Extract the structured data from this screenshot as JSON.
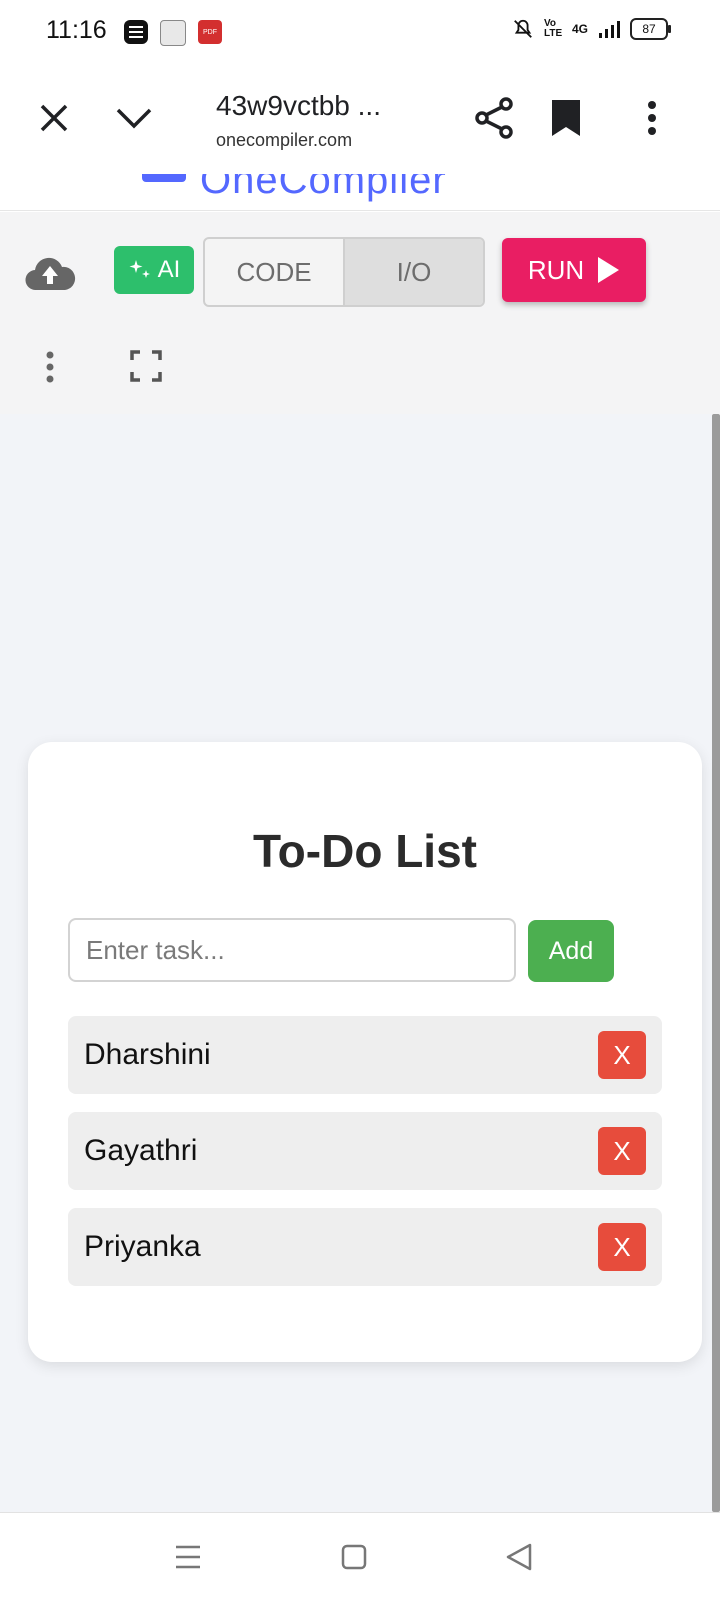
{
  "status_bar": {
    "time": "11:16",
    "network": "4G",
    "volte": "Vo LTE",
    "battery": "87"
  },
  "browser": {
    "title": "43w9vctbb ...",
    "url": "onecompiler.com"
  },
  "site": {
    "brand": "OneCompiler"
  },
  "editor_toolbar": {
    "ai_label": "AI",
    "code_tab": "CODE",
    "io_tab": "I/O",
    "run_label": "RUN"
  },
  "todo": {
    "title": "To-Do List",
    "input_placeholder": "Enter task...",
    "input_value": "",
    "add_label": "Add",
    "tasks": [
      {
        "label": "Dharshini",
        "delete_label": "X"
      },
      {
        "label": "Gayathri",
        "delete_label": "X"
      },
      {
        "label": "Priyanka",
        "delete_label": "X"
      }
    ]
  },
  "colors": {
    "run": "#e91e63",
    "ai": "#2dbf6c",
    "add": "#4caf50",
    "delete": "#e74c3c",
    "brand": "#5468ff"
  }
}
